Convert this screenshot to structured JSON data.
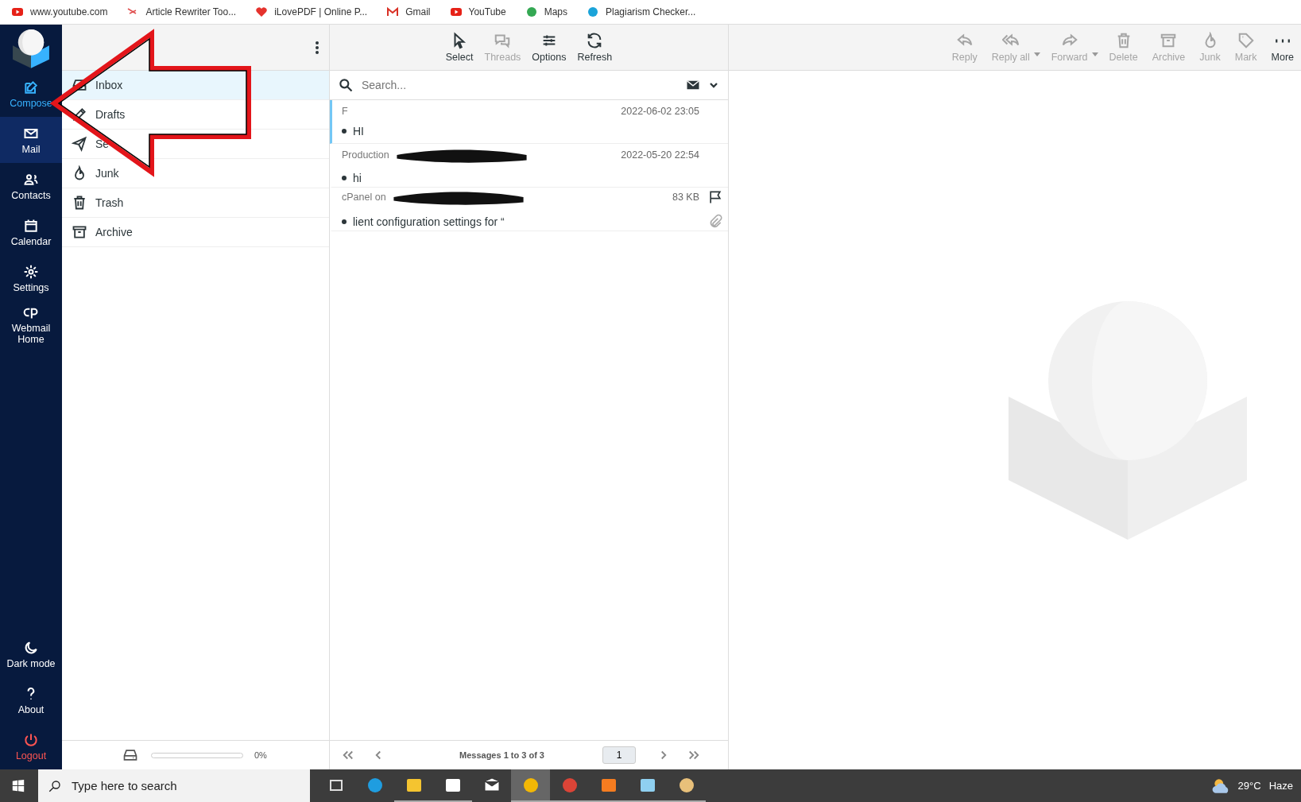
{
  "bookmarks": [
    {
      "label": "www.youtube.com",
      "kind": "youtube"
    },
    {
      "label": "Article Rewriter Too...",
      "kind": "article"
    },
    {
      "label": "iLovePDF | Online P...",
      "kind": "heart"
    },
    {
      "label": "Gmail",
      "kind": "gmail"
    },
    {
      "label": "YouTube",
      "kind": "youtube"
    },
    {
      "label": "Maps",
      "kind": "maps"
    },
    {
      "label": "Plagiarism Checker...",
      "kind": "plagiarism"
    }
  ],
  "nav": [
    {
      "label": "Compose",
      "kind": "compose",
      "selected": false
    },
    {
      "label": "Mail",
      "kind": "mail",
      "selected": true
    },
    {
      "label": "Contacts",
      "kind": "contacts",
      "selected": false
    },
    {
      "label": "Calendar",
      "kind": "calendar",
      "selected": false
    },
    {
      "label": "Settings",
      "kind": "settings",
      "selected": false
    },
    {
      "label": "Webmail Home",
      "kind": "cpanel",
      "selected": false
    }
  ],
  "nav_bottom": [
    {
      "label": "Dark mode",
      "kind": "moon"
    },
    {
      "label": "About",
      "kind": "question"
    },
    {
      "label": "Logout",
      "kind": "power"
    }
  ],
  "folders": [
    {
      "label": "Inbox",
      "kind": "inbox",
      "selected": true
    },
    {
      "label": "Drafts",
      "kind": "drafts",
      "selected": false
    },
    {
      "label": "Se",
      "kind": "sent",
      "selected": false
    },
    {
      "label": "Junk",
      "kind": "junk",
      "selected": false
    },
    {
      "label": "Trash",
      "kind": "trash",
      "selected": false
    },
    {
      "label": "Archive",
      "kind": "archive",
      "selected": false
    }
  ],
  "quota": {
    "reading": "0%"
  },
  "list_toolbar": [
    {
      "label": "Select",
      "kind": "select",
      "disabled": false
    },
    {
      "label": "Threads",
      "kind": "threads",
      "disabled": true
    },
    {
      "label": "Options",
      "kind": "options",
      "disabled": false
    },
    {
      "label": "Refresh",
      "kind": "refresh",
      "disabled": false
    }
  ],
  "search": {
    "placeholder": "Search..."
  },
  "messages": [
    {
      "sender": "F",
      "meta": "2022-06-02 23:05",
      "subject": "HI",
      "unread": true,
      "selected": true
    },
    {
      "sender": "Production",
      "meta": "2022-05-20 22:54",
      "subject": "hi",
      "unread": true,
      "selected": false
    },
    {
      "sender": "cPanel on",
      "meta": "83 KB",
      "subject": "lient configuration settings for “",
      "unread": true,
      "selected": false,
      "flagged": false,
      "attachment": true
    }
  ],
  "pagination": {
    "text": "Messages 1 to 3 of 3",
    "page": "1"
  },
  "message_toolbar": [
    {
      "label": "Reply",
      "kind": "reply",
      "disabled": true
    },
    {
      "label": "Reply all",
      "kind": "replyall",
      "disabled": true,
      "menu": true
    },
    {
      "label": "Forward",
      "kind": "forward",
      "disabled": true,
      "menu": true
    },
    {
      "label": "Delete",
      "kind": "trash",
      "disabled": true
    },
    {
      "label": "Archive",
      "kind": "archive",
      "disabled": true
    },
    {
      "label": "Junk",
      "kind": "junk",
      "disabled": true
    },
    {
      "label": "Mark",
      "kind": "mark",
      "disabled": true
    },
    {
      "label": "More",
      "kind": "more",
      "disabled": false
    }
  ],
  "taskbar": {
    "search_placeholder": "Type here to search",
    "apps": [
      {
        "kind": "taskview",
        "selected": false,
        "running": false
      },
      {
        "kind": "edge",
        "selected": false,
        "running": false
      },
      {
        "kind": "folder",
        "selected": false,
        "running": true
      },
      {
        "kind": "store",
        "selected": false,
        "running": true
      },
      {
        "kind": "mail",
        "selected": false,
        "running": false
      },
      {
        "kind": "shield",
        "selected": true,
        "running": true
      },
      {
        "kind": "chrome",
        "selected": false,
        "running": true
      },
      {
        "kind": "rocket",
        "selected": false,
        "running": true
      },
      {
        "kind": "notepad",
        "selected": false,
        "running": true
      },
      {
        "kind": "palette",
        "selected": false,
        "running": true
      }
    ],
    "temperature": "29°C",
    "weather": "Haze"
  }
}
